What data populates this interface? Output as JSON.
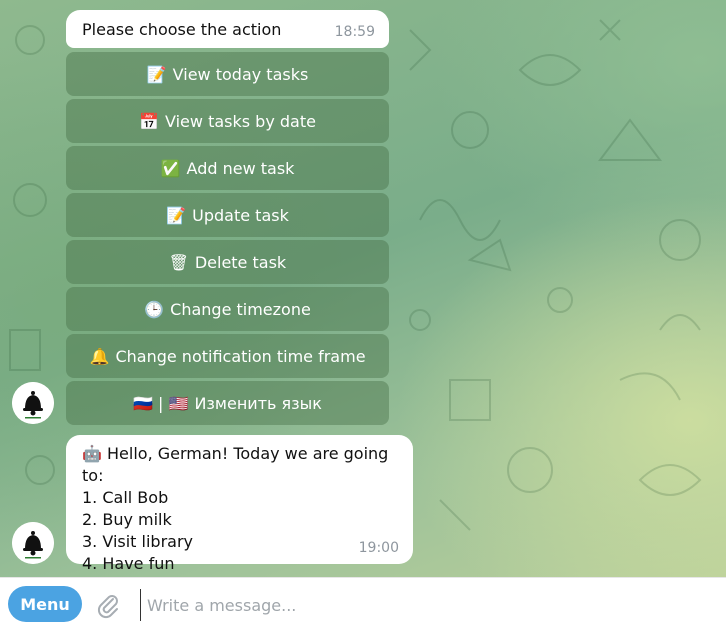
{
  "chat": {
    "prompt_message": {
      "text": "Please choose the action",
      "time": "18:59"
    },
    "keyboard": [
      {
        "emoji": "📝",
        "label": "View today tasks"
      },
      {
        "emoji": "📅",
        "label": "View tasks by date"
      },
      {
        "emoji": "✅",
        "label": "Add new task"
      },
      {
        "emoji": "📝",
        "label": "Update task"
      },
      {
        "emoji": "🗑",
        "label": "Delete task"
      },
      {
        "emoji": "🕒",
        "label": "Change timezone"
      },
      {
        "emoji": "🔔",
        "label": "Change notification time frame"
      },
      {
        "emoji": "🇷🇺 | 🇺🇸",
        "label": "Изменить язык"
      }
    ],
    "task_message": {
      "greeting_emoji": "🤖",
      "greeting": "Hello, German! Today we are going to:",
      "items": [
        "1. Call Bob",
        "2. Buy milk",
        "3. Visit library",
        "4. Have fun"
      ],
      "time": "19:00"
    }
  },
  "composer": {
    "menu_label": "Menu",
    "placeholder": "Write a message..."
  },
  "colors": {
    "menu_button": "#4ba3e2",
    "keyboard_button": "rgba(70,110,70,0.42)",
    "time": "#8e969e"
  },
  "icons": {
    "avatar": "bell-avatar-icon",
    "attach": "paperclip-icon"
  }
}
